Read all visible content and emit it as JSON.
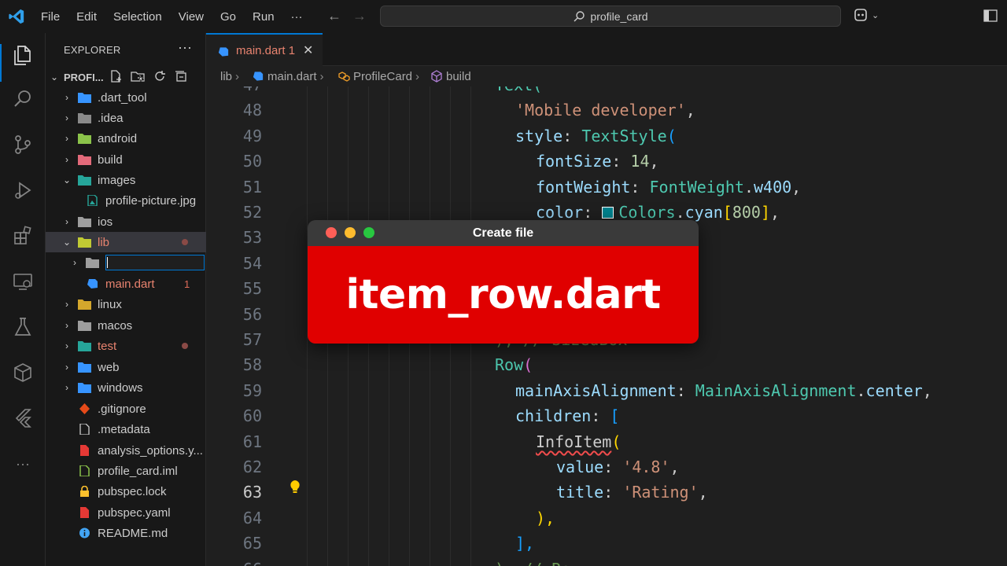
{
  "menu": [
    "File",
    "Edit",
    "Selection",
    "View",
    "Go",
    "Run",
    "···"
  ],
  "search": {
    "text": "profile_card"
  },
  "explorer": {
    "title": "EXPLORER",
    "more": "···",
    "project": "PROFI...",
    "items": [
      {
        "name": ".dart_tool",
        "chevron": "›",
        "color": "#3794ff"
      },
      {
        "name": ".idea",
        "chevron": "›",
        "color": "#8a8a8a"
      },
      {
        "name": "android",
        "chevron": "›",
        "color": "#8bc34a"
      },
      {
        "name": "build",
        "chevron": "›",
        "color": "#e36a7a"
      },
      {
        "name": "images",
        "chevron": "⌄",
        "color": "#26a69a"
      },
      {
        "name": "profile-picture.jpg",
        "color": "#26a69a"
      },
      {
        "name": "ios",
        "chevron": "›",
        "color": "#9e9e9e"
      },
      {
        "name": "lib",
        "chevron": "⌄",
        "color": "#c0ca33"
      },
      {
        "name": "",
        "chevron": "›",
        "color": "#9e9e9e"
      },
      {
        "name": "main.dart",
        "badge": "1",
        "color": "#3794ff"
      },
      {
        "name": "linux",
        "chevron": "›",
        "color": "#d4a72c"
      },
      {
        "name": "macos",
        "chevron": "›",
        "color": "#9e9e9e"
      },
      {
        "name": "test",
        "chevron": "›",
        "color": "#26a69a"
      },
      {
        "name": "web",
        "chevron": "›",
        "color": "#3794ff"
      },
      {
        "name": "windows",
        "chevron": "›",
        "color": "#3794ff"
      },
      {
        "name": ".gitignore",
        "color": "#e64a19"
      },
      {
        "name": ".metadata",
        "color": "#cccccc"
      },
      {
        "name": "analysis_options.y...",
        "color": "#e53935"
      },
      {
        "name": "profile_card.iml",
        "color": "#8bc34a"
      },
      {
        "name": "pubspec.lock",
        "color": "#fbc02d"
      },
      {
        "name": "pubspec.yaml",
        "color": "#e53935"
      },
      {
        "name": "README.md",
        "color": "#42a5f5"
      }
    ]
  },
  "tab": {
    "name": "main.dart",
    "badge": "1",
    "close": "✕"
  },
  "breadcrumb": {
    "folder": "lib",
    "file": "main.dart",
    "cls": "ProfileCard",
    "method": "build"
  },
  "editor": {
    "line_numbers": [
      "47",
      "48",
      "49",
      "50",
      "51",
      "52",
      "53",
      "54",
      "55",
      "56",
      "57",
      "58",
      "59",
      "60",
      "61",
      "62",
      "63",
      "64",
      "65",
      "66"
    ],
    "active_line": "63",
    "code": {
      "l47": "Text(",
      "l48": "'Mobile developer'",
      "l49a": "style",
      "l49b": "TextStyle",
      "l50a": "fontSize",
      "l50b": "14",
      "l51a": "fontWeight",
      "l51b": "FontWeight",
      "l51c": "w400",
      "l52a": "color",
      "l52b": "Colors",
      "l52c": "cyan",
      "l52d": "800",
      "l57a": "), // SizedBox",
      "l58": "Row",
      "l59a": "mainAxisAlignment",
      "l59b": "MainAxisAlignment",
      "l59c": "center",
      "l60a": "children",
      "l61": "InfoItem",
      "l62a": "value",
      "l62b": "'4.8'",
      "l63a": "title",
      "l63b": "'Rating'",
      "l64": "),",
      "l65": "],",
      "l66": "), // Row"
    }
  },
  "dialog": {
    "title": "Create file",
    "text": "item_row.dart"
  }
}
